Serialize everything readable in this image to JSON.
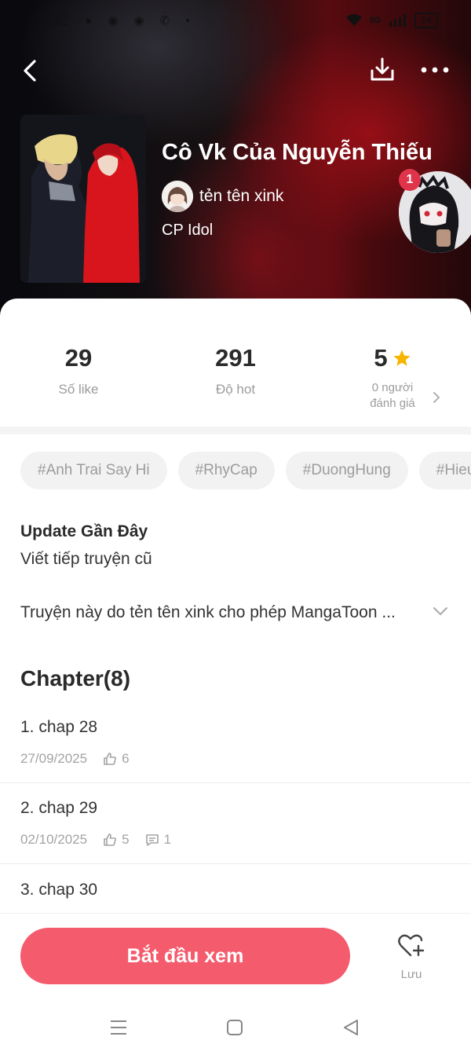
{
  "status_bar": {
    "time": "2:32",
    "battery": "24",
    "network": "5G"
  },
  "story": {
    "title": "Cô Vk Của Nguyễn Thiếu",
    "author": "tẻn tên xink",
    "category": "CP Idol",
    "notification_count": "1"
  },
  "stats": {
    "likes_value": "29",
    "likes_label": "Số like",
    "hot_value": "291",
    "hot_label": "Độ hot",
    "rating_value": "5",
    "rating_label_line1": "0 người",
    "rating_label_line2": "đánh giá"
  },
  "tags": [
    "#Anh Trai Say Hi",
    "#RhyCap",
    "#DuongHung",
    "#Hieu"
  ],
  "update": {
    "title": "Update Gần Đây",
    "text": "Viết tiếp truyện cũ"
  },
  "description": "Truyện này do tẻn tên xink cho phép MangaToon ...",
  "chapters": {
    "heading": "Chapter(8)",
    "items": [
      {
        "title": "1. chap 28",
        "date": "27/09/2025",
        "likes": "6",
        "comments": ""
      },
      {
        "title": "2. chap 29",
        "date": "02/10/2025",
        "likes": "5",
        "comments": "1"
      },
      {
        "title": "3. chap 30",
        "date": "",
        "likes": "",
        "comments": ""
      }
    ]
  },
  "actions": {
    "start_label": "Bắt đầu xem",
    "save_label": "Lưu"
  },
  "colors": {
    "accent": "#f45b6d",
    "badge": "#e0344b",
    "star": "#f7b500"
  },
  "icons": [
    "back-arrow-icon",
    "download-icon",
    "more-icon",
    "star-icon",
    "chevron-right-icon",
    "chevron-down-icon",
    "thumb-up-icon",
    "comment-icon",
    "heart-plus-icon"
  ]
}
